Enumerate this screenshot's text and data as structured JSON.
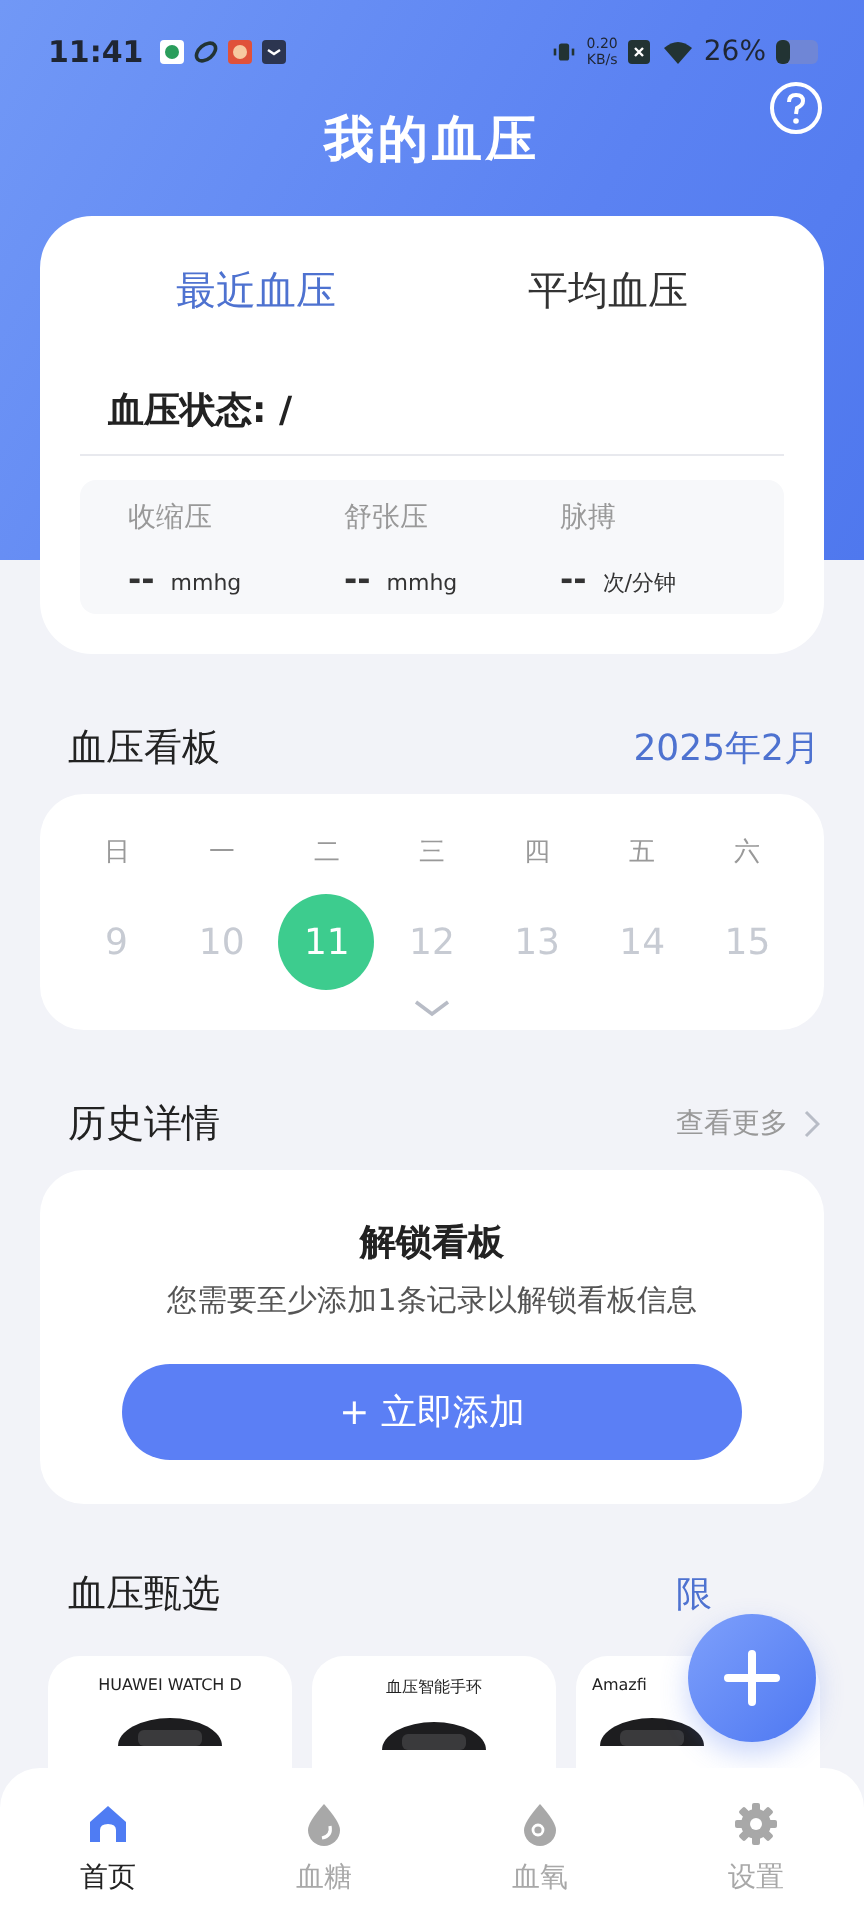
{
  "status_bar": {
    "time": "11:41",
    "net_speed": "0.20",
    "net_unit": "KB/s",
    "battery": "26%"
  },
  "header": {
    "title": "我的血压"
  },
  "summary": {
    "tabs": [
      {
        "label": "最近血压",
        "selected": true
      },
      {
        "label": "平均血压",
        "selected": false
      }
    ],
    "status_label": "血压状态: /",
    "metrics": [
      {
        "label": "收缩压",
        "value": "--",
        "unit": "mmhg"
      },
      {
        "label": "舒张压",
        "value": "--",
        "unit": "mmhg"
      },
      {
        "label": "脉搏",
        "value": "--",
        "unit": "次/分钟"
      }
    ]
  },
  "board": {
    "title": "血压看板",
    "month": "2025年2月",
    "weekdays": [
      "日",
      "一",
      "二",
      "三",
      "四",
      "五",
      "六"
    ],
    "dates": [
      {
        "day": "9",
        "selected": false
      },
      {
        "day": "10",
        "selected": false
      },
      {
        "day": "11",
        "selected": true
      },
      {
        "day": "12",
        "selected": false
      },
      {
        "day": "13",
        "selected": false
      },
      {
        "day": "14",
        "selected": false
      },
      {
        "day": "15",
        "selected": false
      }
    ]
  },
  "history": {
    "title": "历史详情",
    "more": "查看更多",
    "unlock_title": "解锁看板",
    "unlock_text": "您需要至少添加1条记录以解锁看板信息",
    "add_button": "+ 立即添加"
  },
  "picks": {
    "title": "血压甄选",
    "link": "限",
    "products": [
      {
        "name": "HUAWEI WATCH D"
      },
      {
        "name": "血压智能手环"
      },
      {
        "name": "Amazfi"
      }
    ]
  },
  "nav": [
    {
      "label": "首页",
      "selected": true
    },
    {
      "label": "血糖",
      "selected": false
    },
    {
      "label": "血氧",
      "selected": false
    },
    {
      "label": "设置",
      "selected": false
    }
  ]
}
